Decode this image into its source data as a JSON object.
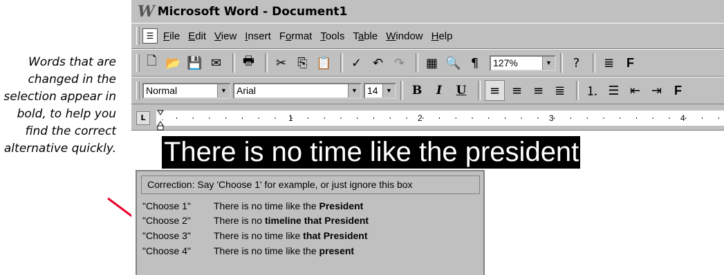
{
  "caption": "Words that are changed in the selection appear in bold, to help you find the correct alternative quickly.",
  "window": {
    "title": "Microsoft Word - Document1"
  },
  "menu": [
    "File",
    "Edit",
    "View",
    "Insert",
    "Format",
    "Tools",
    "Table",
    "Window",
    "Help"
  ],
  "menu_mnemonics": [
    "F",
    "E",
    "V",
    "I",
    "o",
    "T",
    "a",
    "W",
    "H"
  ],
  "toolbar": {
    "zoom": "127%",
    "style": "Normal",
    "font": "Arial",
    "size": "14",
    "bold": "B",
    "italic": "I",
    "underline": "U",
    "extra": "F"
  },
  "ruler": {
    "marks": [
      "1",
      "2",
      "3",
      "4"
    ]
  },
  "document": {
    "selected_text": "There is no time like the president"
  },
  "correction": {
    "header": "Correction: Say 'Choose 1' for example, or just ignore this box",
    "options": [
      {
        "cmd": "\"Choose 1\"",
        "plain": "There is no time like the ",
        "bold": "President"
      },
      {
        "cmd": "\"Choose 2\"",
        "plain": "There is no ",
        "bold": "timeline that President"
      },
      {
        "cmd": "\"Choose 3\"",
        "plain": "There is no time like ",
        "bold": "that President"
      },
      {
        "cmd": "\"Choose 4\"",
        "plain": "There is no time like the ",
        "bold": "present"
      }
    ]
  },
  "colors": {
    "chrome": "#c0c0c0",
    "pointer": "#e8002a",
    "selection": "#000000"
  },
  "icons": [
    "word-logo-icon",
    "new-doc-icon",
    "open-icon",
    "save-icon",
    "print-icon",
    "cut-icon",
    "copy-icon",
    "paste-icon",
    "spelling-icon",
    "undo-icon",
    "redo-icon",
    "table-icon",
    "print-preview-icon",
    "pilcrow-icon",
    "help-icon",
    "columns-icon"
  ]
}
